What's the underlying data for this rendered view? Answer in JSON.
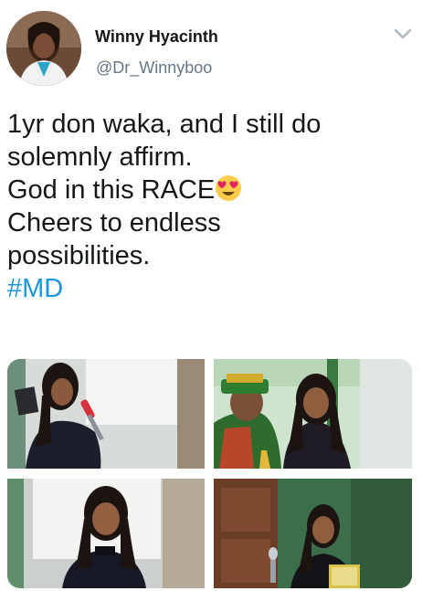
{
  "tweet": {
    "author": {
      "display_name": "Winny Hyacinth",
      "handle": "@Dr_Winnyboo",
      "avatar_icon": "profile-photo"
    },
    "menu_icon": "chevron-down-icon",
    "text_lines": [
      "1yr don waka, and I still do",
      "solemnly affirm.",
      "God in this RACE",
      "Cheers to endless",
      "possibilities."
    ],
    "emoji": "heart-eyes-emoji",
    "hashtag": "#MD",
    "colors": {
      "text": "#14171a",
      "secondary": "#657786",
      "link": "#1b95e0"
    },
    "media": [
      {
        "name": "photo-speaker-with-microphone"
      },
      {
        "name": "photo-with-academic-officer"
      },
      {
        "name": "photo-portrait-in-front-of-screen"
      },
      {
        "name": "photo-holding-award-plaque"
      }
    ]
  }
}
